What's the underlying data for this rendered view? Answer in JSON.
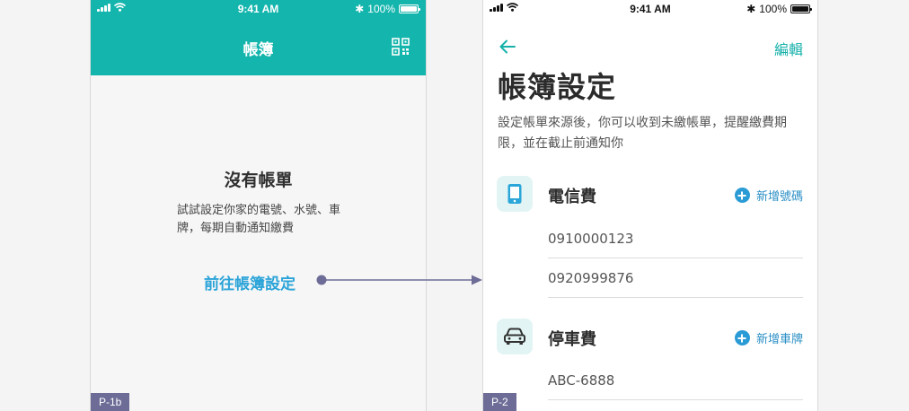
{
  "status_bar": {
    "time": "9:41 AM",
    "battery": "100%",
    "bluetooth": "✱"
  },
  "left_screen": {
    "nav_title": "帳簿",
    "empty_title": "沒有帳單",
    "empty_desc": "試試設定你家的電號、水號、車牌，每期自動通知繳費",
    "goto_link": "前往帳簿設定",
    "page_tag": "P-1b",
    "header_color": "#14b5ad"
  },
  "right_screen": {
    "edit_label": "編輯",
    "title": "帳簿設定",
    "description": "設定帳單來源後，你可以收到未繳帳單，提醒繳費期限，並在截止前通知你",
    "page_tag": "P-2",
    "sections": [
      {
        "title": "電信費",
        "icon": "phone-icon",
        "add_label": "新增號碼",
        "entries": [
          "0910000123",
          "0920999876"
        ]
      },
      {
        "title": "停車費",
        "icon": "car-icon",
        "add_label": "新增車牌",
        "entries": [
          "ABC-6888"
        ]
      }
    ]
  },
  "colors": {
    "accent": "#14b5ad",
    "link": "#2ba4d8",
    "tag": "#6d6c97",
    "connector": "#6d6c97"
  }
}
